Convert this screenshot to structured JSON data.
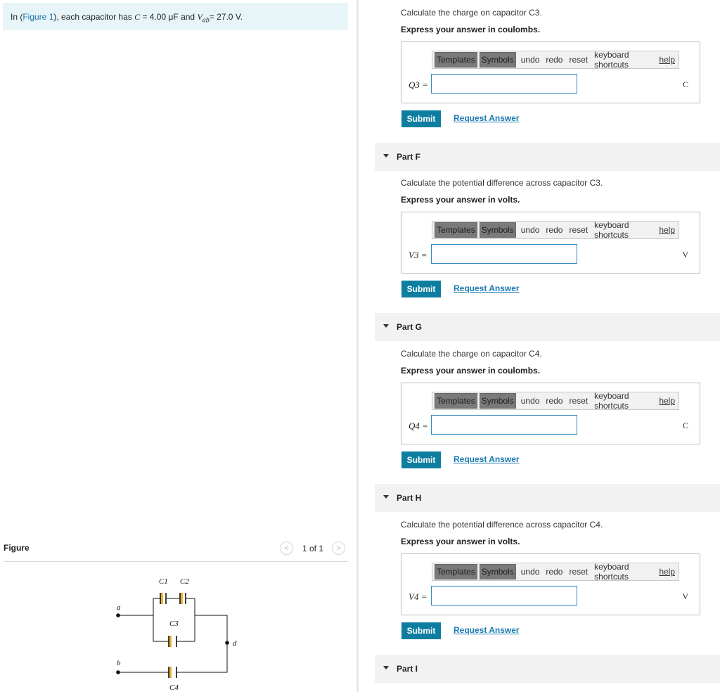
{
  "intro": {
    "prefix": "In (",
    "figure_link": "Figure 1",
    "middle": "), each capacitor has ",
    "c_symbol": "C",
    "c_value": " = 4.00 μF",
    "and_text": " and ",
    "v_symbol": "V",
    "v_sub": "ab",
    "v_value": "= 27.0 V."
  },
  "figure": {
    "title": "Figure",
    "pager_prev": "<",
    "pager_count": "1 of 1",
    "pager_next": ">",
    "labels": {
      "c1": "C1",
      "c2": "C2",
      "c3": "C3",
      "c4": "C4",
      "a": "a",
      "b": "b",
      "d": "d"
    }
  },
  "toolbar": {
    "templates": "Templates",
    "symbols": "Symbols",
    "undo": "undo",
    "redo": "redo",
    "reset": "reset",
    "shortcuts": "keyboard shortcuts",
    "help": "help"
  },
  "submit_label": "Submit",
  "request_label": "Request Answer",
  "parts": [
    {
      "prompt": "Calculate the charge on capacitor C3.",
      "instr": "Express your answer in coulombs.",
      "var": "Q3 =",
      "unit": "C"
    },
    {
      "title": "Part F",
      "prompt": "Calculate the potential difference across capacitor C3.",
      "instr": "Express your answer in volts.",
      "var": "V3 =",
      "unit": "V"
    },
    {
      "title": "Part G",
      "prompt": "Calculate the charge on capacitor C4.",
      "instr": "Express your answer in coulombs.",
      "var": "Q4 =",
      "unit": "C"
    },
    {
      "title": "Part H",
      "prompt": "Calculate the potential difference across capacitor C4.",
      "instr": "Express your answer in volts.",
      "var": "V4 =",
      "unit": "V"
    },
    {
      "title": "Part I"
    }
  ],
  "colors": {
    "accent": "#0d7ea0",
    "link": "#1c7ab3",
    "intro_bg": "#e7f5f8",
    "capacitor": "#e8b23a"
  }
}
